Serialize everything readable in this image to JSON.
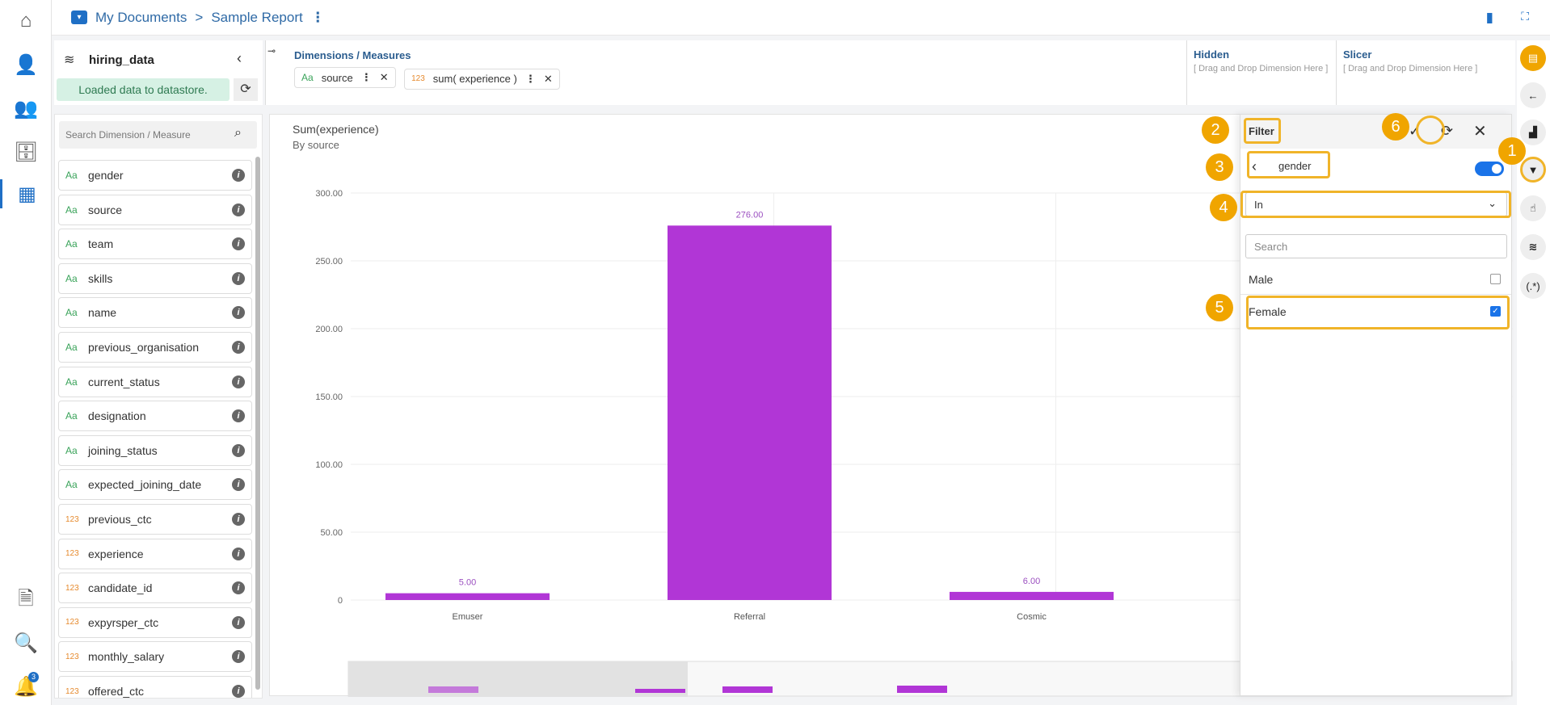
{
  "header": {
    "folder": "My Documents",
    "separator": ">",
    "report": "Sample Report"
  },
  "nav": {
    "notification_count": "3"
  },
  "dataset": {
    "name": "hiring_data",
    "status": "Loaded data to datastore."
  },
  "dims": {
    "title": "Dimensions / Measures",
    "chips": [
      {
        "type": "Aa",
        "label": "source"
      },
      {
        "type": "123",
        "label": "sum( experience )"
      }
    ]
  },
  "hidden": {
    "title": "Hidden",
    "hint": "[ Drag and Drop Dimension Here ]"
  },
  "slicer": {
    "title": "Slicer",
    "hint": "[ Drag and Drop Dimension Here ]"
  },
  "fields": {
    "search_placeholder": "Search Dimension / Measure",
    "items": [
      {
        "type": "Aa",
        "name": "gender"
      },
      {
        "type": "Aa",
        "name": "source"
      },
      {
        "type": "Aa",
        "name": "team"
      },
      {
        "type": "Aa",
        "name": "skills"
      },
      {
        "type": "Aa",
        "name": "name"
      },
      {
        "type": "Aa",
        "name": "previous_organisation"
      },
      {
        "type": "Aa",
        "name": "current_status"
      },
      {
        "type": "Aa",
        "name": "designation"
      },
      {
        "type": "Aa",
        "name": "joining_status"
      },
      {
        "type": "Aa",
        "name": "expected_joining_date"
      },
      {
        "type": "123",
        "name": "previous_ctc"
      },
      {
        "type": "123",
        "name": "experience"
      },
      {
        "type": "123",
        "name": "candidate_id"
      },
      {
        "type": "123",
        "name": "expyrsper_ctc"
      },
      {
        "type": "123",
        "name": "monthly_salary"
      },
      {
        "type": "123",
        "name": "offered_ctc"
      }
    ]
  },
  "chart_data": {
    "type": "bar",
    "title": "Sum(experience)",
    "subtitle": "By source",
    "categories": [
      "Emuser",
      "Referral",
      "Cosmic"
    ],
    "values": [
      5,
      276,
      6
    ],
    "value_labels": [
      "5.00",
      "276.00",
      "6.00"
    ],
    "yticks": [
      "0",
      "50.00",
      "100.00",
      "150.00",
      "200.00",
      "250.00",
      "300.00"
    ],
    "ylim": [
      0,
      300
    ],
    "color": "#b136d6"
  },
  "filter": {
    "title": "Filter",
    "field": "gender",
    "operator": "In",
    "search_placeholder": "Search",
    "options": [
      {
        "label": "Male",
        "checked": false
      },
      {
        "label": "Female",
        "checked": true
      }
    ],
    "enabled": true
  },
  "callouts": [
    "1",
    "2",
    "3",
    "4",
    "5",
    "6"
  ],
  "right_strip": {
    "regex_label": "(.*)"
  }
}
